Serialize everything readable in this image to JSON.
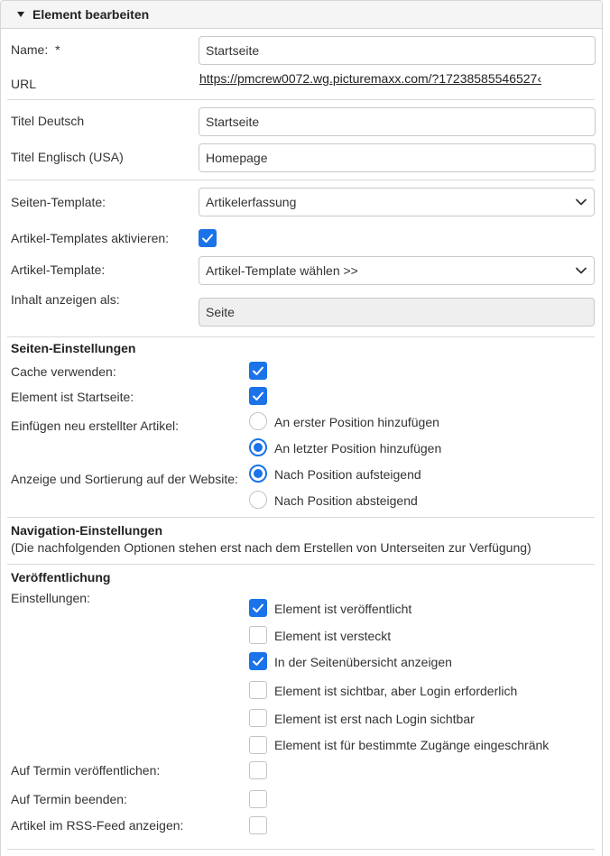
{
  "panel": {
    "title": "Element bearbeiten"
  },
  "fields": {
    "name_label": "Name:",
    "name_required": "*",
    "name_value": "Startseite",
    "url_label": "URL",
    "url_value": "https://pmcrew0072.wg.picturemaxx.com/?17238585546527‹",
    "title_de_label": "Titel Deutsch",
    "title_de_value": "Startseite",
    "title_en_label": "Titel Englisch (USA)",
    "title_en_value": "Homepage",
    "page_template_label": "Seiten-Template:",
    "page_template_value": "Artikelerfassung",
    "article_templates_label": "Artikel-Templates aktivieren:",
    "article_templates_checked": true,
    "article_template_label": "Artikel-Template:",
    "article_template_value": "Artikel-Template wählen >>",
    "content_as_label": "Inhalt anzeigen als:",
    "content_as_value": "Seite"
  },
  "page_settings": {
    "title": "Seiten-Einstellungen",
    "cache_label": "Cache verwenden:",
    "cache_checked": true,
    "startpage_label": "Element ist Startseite:",
    "startpage_checked": true,
    "insert_label": "Einfügen neu erstellter Artikel:",
    "insert_options": [
      {
        "label": "An erster Position hinzufügen",
        "selected": false
      },
      {
        "label": "An letzter Position hinzufügen",
        "selected": true
      }
    ],
    "sort_label": "Anzeige und Sortierung auf der Website:",
    "sort_options": [
      {
        "label": "Nach Position aufsteigend",
        "selected": true
      },
      {
        "label": "Nach Position absteigend",
        "selected": false
      }
    ]
  },
  "navigation": {
    "title": "Navigation-Einstellungen",
    "note": "(Die nachfolgenden Optionen stehen erst nach dem Erstellen von Unterseiten zur Verfügung)"
  },
  "publication": {
    "title": "Veröffentlichung",
    "settings_label": "Einstellungen:",
    "options": [
      {
        "label": "Element ist veröffentlicht",
        "checked": true
      },
      {
        "label": "Element ist versteckt",
        "checked": false
      },
      {
        "label": "In der Seitenübersicht anzeigen",
        "checked": true
      },
      {
        "label": "Element ist sichtbar, aber Login erforderlich",
        "checked": false
      },
      {
        "label": "Element ist erst nach Login sichtbar",
        "checked": false
      },
      {
        "label": "Element ist für bestimmte Zugänge eingeschränk",
        "checked": false
      }
    ],
    "schedule_publish_label": "Auf Termin veröffentlichen:",
    "schedule_publish_checked": false,
    "schedule_end_label": "Auf Termin beenden:",
    "schedule_end_checked": false,
    "rss_label": "Artikel im RSS-Feed anzeigen:",
    "rss_checked": false
  },
  "colors": {
    "accent": "#1a73e8",
    "border": "#c9c9c9",
    "header_bg": "#f5f5f5"
  }
}
